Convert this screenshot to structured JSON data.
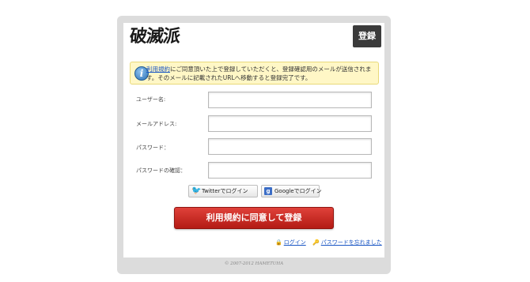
{
  "header": {
    "logo_text": "破滅派",
    "register_tab": "登録"
  },
  "notice": {
    "terms_link": "利用規約",
    "text": "にご同意頂いた上で登録していただくと、登録確認用のメールが送信されます。そのメールに記載されたURLへ移動すると登録完了です。"
  },
  "form": {
    "username_label": "ユーザー名:",
    "email_label": "メールアドレス:",
    "password_label": "パスワード：",
    "password_confirm_label": "パスワードの確認："
  },
  "social": {
    "twitter_label": "Twitterでログイン",
    "google_label": "Googleでログイン"
  },
  "submit_label": "利用規約に同意して登録",
  "links": {
    "login": "ログイン",
    "forgot_password": "パスワードを忘れました"
  },
  "footer": {
    "copyright": "© 2007-2012 HAMETUHA"
  },
  "colors": {
    "primary_button": "#c62b22",
    "notice_bg": "#fff7c6",
    "link": "#1a56c4",
    "frame": "#dcdcdc",
    "tab": "#3b3b3b"
  }
}
